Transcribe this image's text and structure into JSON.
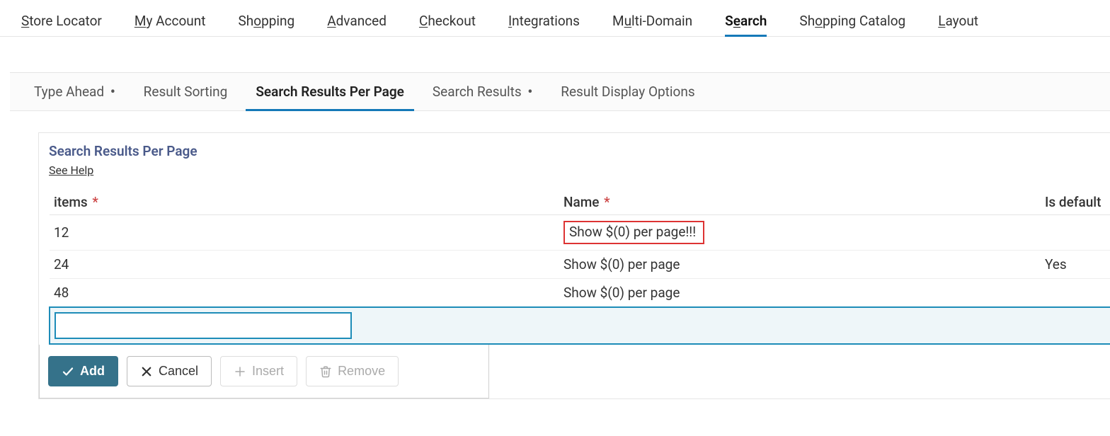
{
  "topnav": {
    "items": [
      {
        "pre": "",
        "u": "S",
        "post": "tore Locator"
      },
      {
        "pre": "",
        "u": "M",
        "post": "y Account"
      },
      {
        "pre": "Sh",
        "u": "o",
        "post": "pping"
      },
      {
        "pre": "",
        "u": "A",
        "post": "dvanced"
      },
      {
        "pre": "",
        "u": "C",
        "post": "heckout"
      },
      {
        "pre": "",
        "u": "I",
        "post": "ntegrations"
      },
      {
        "pre": "M",
        "u": "u",
        "post": "lti-Domain"
      },
      {
        "pre": "S",
        "u": "e",
        "post": "arch",
        "active": true
      },
      {
        "pre": "Sh",
        "u": "o",
        "post": "pping Catalog"
      },
      {
        "pre": "",
        "u": "L",
        "post": "ayout"
      }
    ]
  },
  "subtabs": {
    "items": [
      {
        "label": "Type Ahead",
        "dot": true
      },
      {
        "label": "Result Sorting"
      },
      {
        "label": "Search Results Per Page",
        "active": true
      },
      {
        "label": "Search Results",
        "dot": true
      },
      {
        "label": "Result Display Options"
      }
    ]
  },
  "section": {
    "title": "Search Results Per Page",
    "help_link": "See Help"
  },
  "table": {
    "columns": {
      "items": "items",
      "name": "Name",
      "is_default": "Is default"
    },
    "rows": [
      {
        "items": "12",
        "name": "Show $(0) per page!!!",
        "is_default": "",
        "highlight": true
      },
      {
        "items": "24",
        "name": "Show $(0) per page",
        "is_default": "Yes"
      },
      {
        "items": "48",
        "name": "Show $(0) per page",
        "is_default": ""
      }
    ],
    "new_row_value": ""
  },
  "actions": {
    "add": "Add",
    "cancel": "Cancel",
    "insert": "Insert",
    "remove": "Remove"
  }
}
